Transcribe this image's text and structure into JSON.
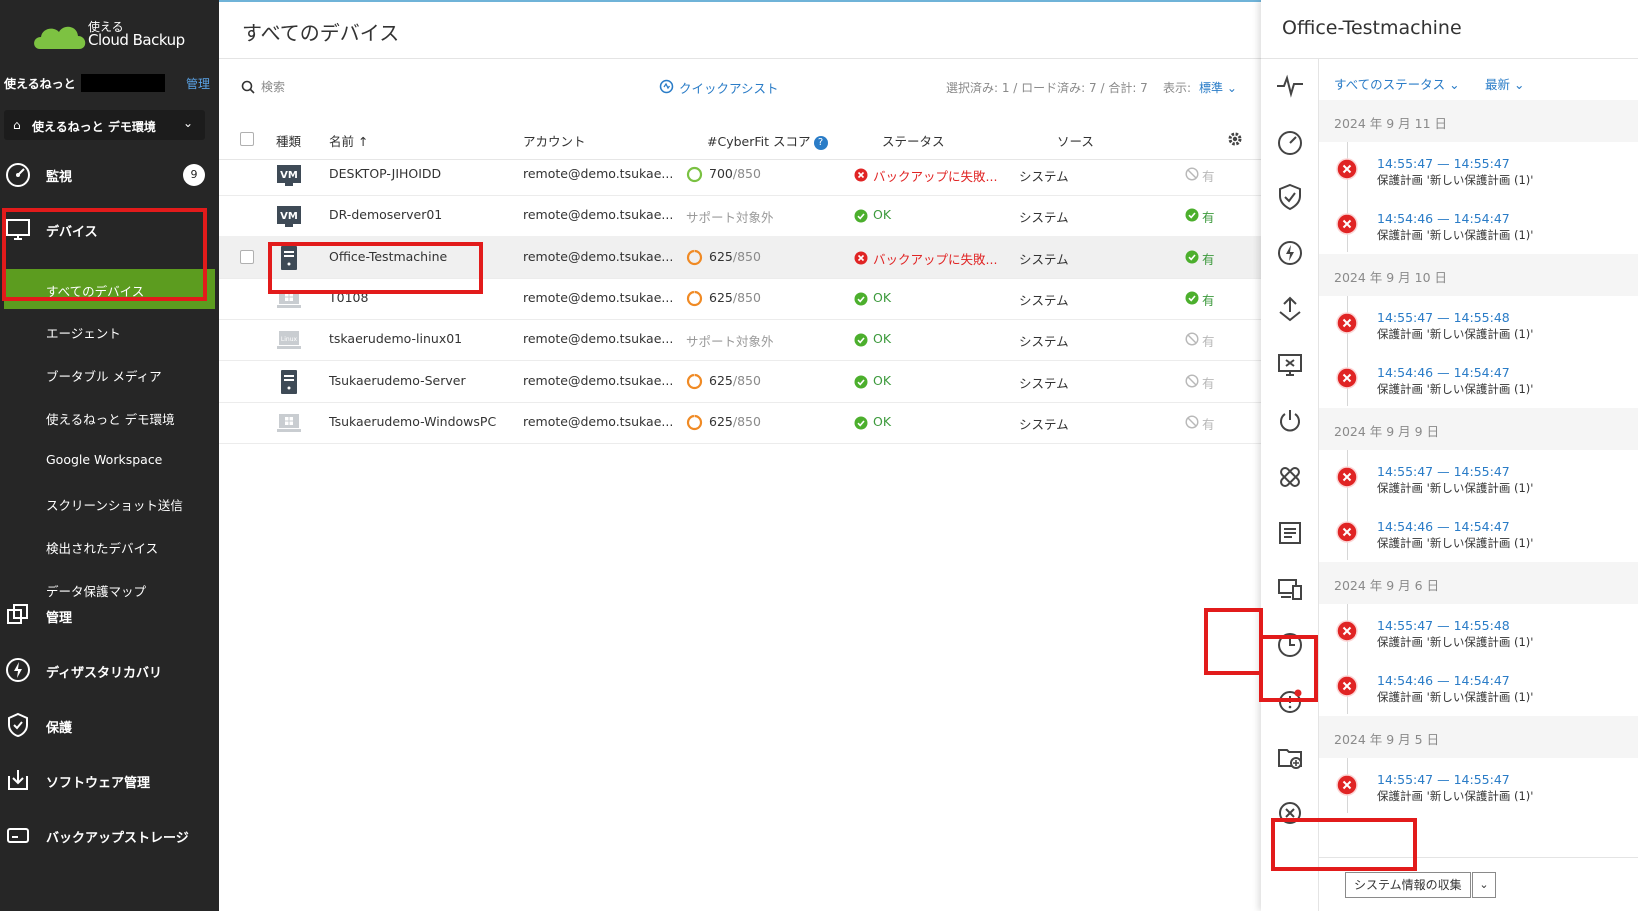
{
  "brand": {
    "logo_text_top": "使える",
    "logo_text_bottom": "Cloud Backup",
    "accent": "#5c9c1f",
    "highlight": "#e21b1b",
    "link": "#2a7cc7"
  },
  "tenant": {
    "name": "使えるねっと",
    "manage": "管理",
    "selected": "使えるねっと デモ環境"
  },
  "sidebar": {
    "monitor": {
      "label": "監視",
      "icon": "dashboard-icon",
      "badge": "9"
    },
    "devices": {
      "label": "デバイス",
      "icon": "monitor-icon"
    },
    "device_items": [
      {
        "label": "すべてのデバイス",
        "active": true
      },
      {
        "label": "エージェント"
      },
      {
        "label": "ブータブル メディア"
      },
      {
        "label": "使えるねっと デモ環境"
      },
      {
        "label": "Google Workspace"
      },
      {
        "label": "スクリーンショット送信"
      },
      {
        "label": "検出されたデバイス"
      },
      {
        "label": "データ保護マップ"
      }
    ],
    "management": {
      "label": "管理",
      "icon": "copy-icon"
    },
    "disaster": {
      "label": "ディザスタリカバリ",
      "icon": "lightning-icon"
    },
    "protection": {
      "label": "保護",
      "icon": "shield-icon"
    },
    "software": {
      "label": "ソフトウェア管理",
      "icon": "download-box-icon"
    },
    "storage": {
      "label": "バックアップストレージ",
      "icon": "drive-icon"
    }
  },
  "main": {
    "title": "すべてのデバイス",
    "search_placeholder": "検索",
    "quick_assist": "クイックアシスト",
    "selection_info": "選択済み: 1 / ロード済み: 7 / 合計: 7",
    "display_label": "表示:",
    "display_value": "標準 ⌄",
    "columns": {
      "type": "種類",
      "name": "名前 ↑",
      "account": "アカウント",
      "score": "#CyberFit スコア",
      "status": "ステータス",
      "source": "ソース"
    },
    "rows": [
      {
        "icon": "vm-icon",
        "name": "DESKTOP-JIHOIDD",
        "account": "remote@demo.tsukae...",
        "score": "700",
        "score_max": "/850",
        "score_kind": "green",
        "status": "バックアップに失敗...",
        "status_kind": "error",
        "source": "システム",
        "tail": "有",
        "tail_kind": "disabled"
      },
      {
        "icon": "vm-icon",
        "name": "DR-demoserver01",
        "account": "remote@demo.tsukae...",
        "score": "サポート対象外",
        "score_max": "",
        "score_kind": "none",
        "status": "OK",
        "status_kind": "ok",
        "source": "システム",
        "tail": "有",
        "tail_kind": "ok"
      },
      {
        "icon": "server-icon",
        "name": "Office-Testmachine",
        "account": "remote@demo.tsukae...",
        "score": "625",
        "score_max": "/850",
        "score_kind": "orange",
        "status": "バックアップに失敗...",
        "status_kind": "error",
        "source": "システム",
        "tail": "有",
        "tail_kind": "ok",
        "selected": true
      },
      {
        "icon": "windows-laptop-icon",
        "name": "T0108",
        "account": "remote@demo.tsukae...",
        "score": "625",
        "score_max": "/850",
        "score_kind": "orange",
        "status": "OK",
        "status_kind": "ok",
        "source": "システム",
        "tail": "有",
        "tail_kind": "ok"
      },
      {
        "icon": "linux-laptop-icon",
        "name": "tskaerudemo-linux01",
        "account": "remote@demo.tsukae...",
        "score": "サポート対象外",
        "score_max": "",
        "score_kind": "none",
        "status": "OK",
        "status_kind": "ok",
        "source": "システム",
        "tail": "有",
        "tail_kind": "disabled"
      },
      {
        "icon": "server-icon",
        "name": "Tsukaerudemo-Server",
        "account": "remote@demo.tsukae...",
        "score": "625",
        "score_max": "/850",
        "score_kind": "orange",
        "status": "OK",
        "status_kind": "ok",
        "source": "システム",
        "tail": "有",
        "tail_kind": "disabled"
      },
      {
        "icon": "windows-laptop-icon",
        "name": "Tsukaerudemo-WindowsPC",
        "account": "remote@demo.tsukae...",
        "score": "625",
        "score_max": "/850",
        "score_kind": "orange",
        "status": "OK",
        "status_kind": "ok",
        "source": "システム",
        "tail": "有",
        "tail_kind": "disabled"
      }
    ]
  },
  "panel": {
    "title": "Office-Testmachine",
    "filter_status": "すべてのステータス ⌄",
    "filter_sort": "最新 ⌄",
    "rail_icons": [
      "pulse-icon",
      "gauge-icon",
      "shield-check-icon",
      "lightning-icon",
      "upload-icon",
      "remote-desktop-icon",
      "power-icon",
      "patch-icon",
      "document-list-icon",
      "devices-icon",
      "clock-icon",
      "alert-icon",
      "folder-plus-icon",
      "close-circle-icon"
    ],
    "groups": [
      {
        "date": "2024 年 9 月 11 日",
        "items": [
          {
            "time": "14:55:47 — 14:55:47",
            "desc": "保護計画 '新しい保護計画 (1)'"
          },
          {
            "time": "14:54:46 — 14:54:47",
            "desc": "保護計画 '新しい保護計画 (1)'"
          }
        ]
      },
      {
        "date": "2024 年 9 月 10 日",
        "items": [
          {
            "time": "14:55:47 — 14:55:48",
            "desc": "保護計画 '新しい保護計画 (1)'"
          },
          {
            "time": "14:54:46 — 14:54:47",
            "desc": "保護計画 '新しい保護計画 (1)'"
          }
        ]
      },
      {
        "date": "2024 年 9 月 9 日",
        "items": [
          {
            "time": "14:55:47 — 14:55:47",
            "desc": "保護計画 '新しい保護計画 (1)'"
          },
          {
            "time": "14:54:46 — 14:54:47",
            "desc": "保護計画 '新しい保護計画 (1)'"
          }
        ]
      },
      {
        "date": "2024 年 9 月 6 日",
        "items": [
          {
            "time": "14:55:47 — 14:55:48",
            "desc": "保護計画 '新しい保護計画 (1)'"
          },
          {
            "time": "14:54:46 — 14:54:47",
            "desc": "保護計画 '新しい保護計画 (1)'"
          }
        ]
      },
      {
        "date": "2024 年 9 月 5 日",
        "items": [
          {
            "time": "14:55:47 — 14:55:47",
            "desc": "保護計画 '新しい保護計画 (1)'"
          }
        ]
      }
    ],
    "collect_button": "システム情報の収集"
  }
}
